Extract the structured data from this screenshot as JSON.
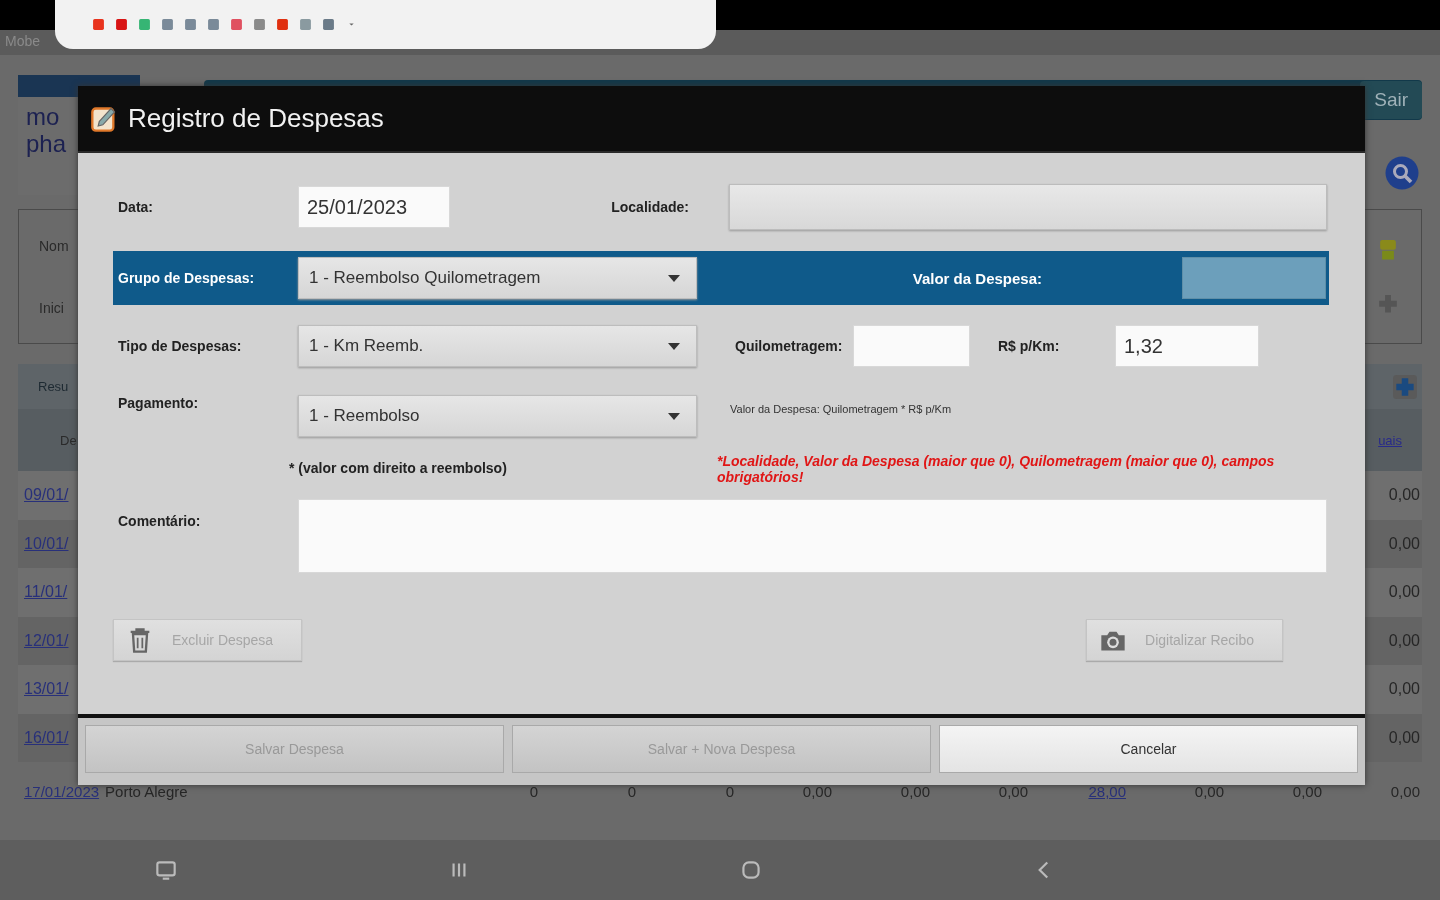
{
  "background_app": {
    "header_text": "Mobe",
    "logo_lines": [
      "mo",
      "pha"
    ],
    "exit_button": "Sair",
    "filter_labels": [
      "Nom",
      "Inici"
    ],
    "summary_label": "Resu",
    "table_header": "De",
    "table_header_link": "uais",
    "rows": [
      {
        "date": "09/01/",
        "total": "0,00"
      },
      {
        "date": "10/01/",
        "total": "0,00"
      },
      {
        "date": "11/01/",
        "total": "0,00"
      },
      {
        "date": "12/01/",
        "total": "0,00"
      },
      {
        "date": "13/01/",
        "total": "0,00"
      },
      {
        "date": "16/01/",
        "total": "0,00"
      }
    ],
    "last_row": {
      "date": "17/01/2023",
      "city": "Porto Alegre",
      "values": [
        "0",
        "0",
        "0",
        "0,00",
        "0,00",
        "0,00",
        "28,00",
        "0,00",
        "0,00",
        "0,00"
      ]
    }
  },
  "dialog": {
    "title": "Registro de Despesas",
    "date": {
      "label": "Data:",
      "value": "25/01/2023"
    },
    "locality": {
      "label": "Localidade:"
    },
    "group": {
      "label": "Grupo de Despesas:",
      "value": "1 - Reembolso Quilometragem"
    },
    "expense_value": {
      "label": "Valor da Despesa:"
    },
    "type": {
      "label": "Tipo de Despesas:",
      "value": "1 - Km Reemb."
    },
    "mileage": {
      "label": "Quilometragem:"
    },
    "rate": {
      "label": "R$ p/Km:",
      "value": "1,32"
    },
    "payment": {
      "label": "Pagamento:",
      "value": "1 - Reembolso"
    },
    "formula": "Valor da Despesa: Quilometragem * R$ p/Km",
    "payment_note": "* (valor com direito a reembolso)",
    "error": "*Localidade, Valor da Despesa (maior que 0), Quilometragem (maior que 0), campos obrigatórios!",
    "comment": {
      "label": "Comentário:"
    },
    "actions": [
      {
        "label": "Excluir Despesa",
        "kind": "delete",
        "disabled": true
      },
      {
        "label": "Digitalizar Recibo",
        "kind": "scan",
        "disabled": true
      }
    ],
    "footer_buttons": [
      {
        "label": "Salvar Despesa",
        "disabled": true
      },
      {
        "label": "Salvar + Nova Despesa",
        "disabled": true
      },
      {
        "label": "Cancelar",
        "disabled": false
      }
    ]
  }
}
